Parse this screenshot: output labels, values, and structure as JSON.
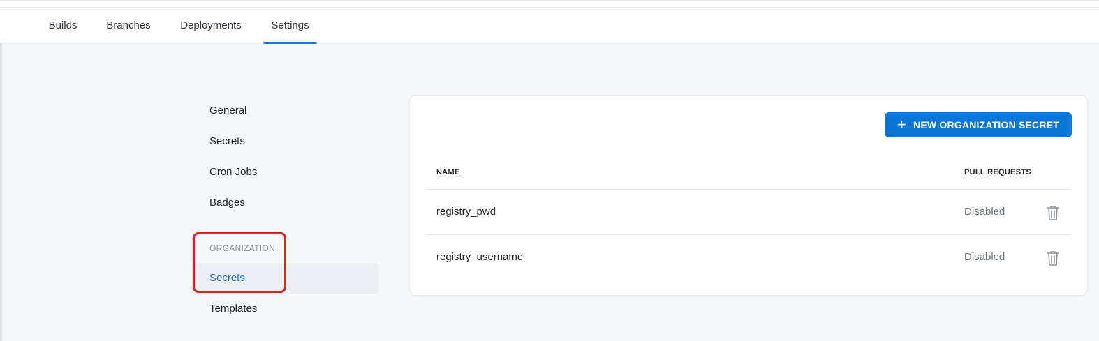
{
  "tabs": [
    {
      "label": "Builds",
      "active": false
    },
    {
      "label": "Branches",
      "active": false
    },
    {
      "label": "Deployments",
      "active": false
    },
    {
      "label": "Settings",
      "active": true
    }
  ],
  "settings_nav": {
    "items": [
      "General",
      "Secrets",
      "Cron Jobs",
      "Badges"
    ],
    "section_label": "ORGANIZATION",
    "org_items": [
      {
        "label": "Secrets",
        "active": true
      },
      {
        "label": "Templates",
        "active": false
      }
    ]
  },
  "secrets_card": {
    "new_button_label": "NEW ORGANIZATION SECRET",
    "columns": {
      "name": "NAME",
      "pull_requests": "PULL REQUESTS"
    },
    "rows": [
      {
        "name": "registry_pwd",
        "pull_requests": "Disabled"
      },
      {
        "name": "registry_username",
        "pull_requests": "Disabled"
      }
    ]
  },
  "colors": {
    "accent": "#0b76d6",
    "annotation": "#e2211c"
  },
  "icons": {
    "button_icon": "plus-icon",
    "row_action_icon": "trash-icon"
  }
}
